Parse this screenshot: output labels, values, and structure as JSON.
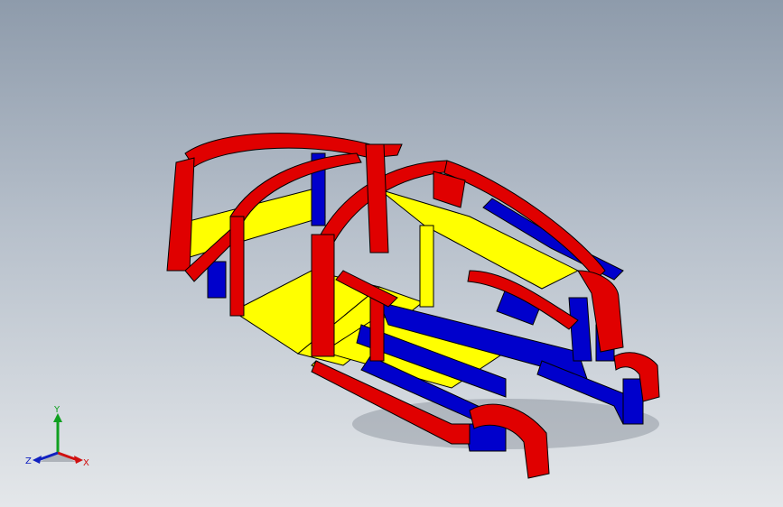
{
  "viewport": {
    "model": "car-body-frame",
    "colors": {
      "frame_red": "#e00000",
      "frame_blue": "#0000cc",
      "frame_yellow": "#ffff00",
      "edge": "#000000"
    }
  },
  "triad": {
    "x_label": "X",
    "y_label": "Y",
    "z_label": "Z",
    "x_color": "#d01010",
    "y_color": "#10a020",
    "z_color": "#1020c0"
  }
}
